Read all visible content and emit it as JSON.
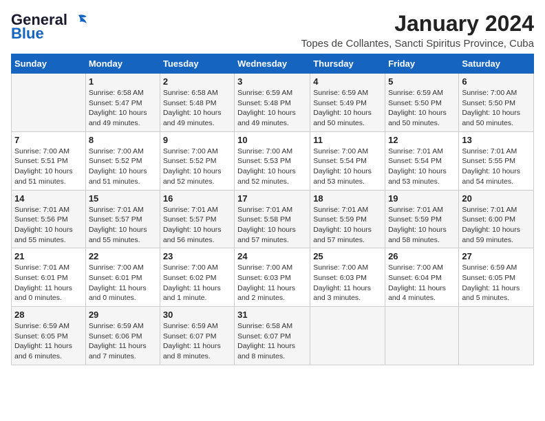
{
  "header": {
    "logo_general": "General",
    "logo_blue": "Blue",
    "title": "January 2024",
    "subtitle": "Topes de Collantes, Sancti Spiritus Province, Cuba"
  },
  "weekdays": [
    "Sunday",
    "Monday",
    "Tuesday",
    "Wednesday",
    "Thursday",
    "Friday",
    "Saturday"
  ],
  "weeks": [
    [
      {
        "day": "",
        "info": ""
      },
      {
        "day": "1",
        "info": "Sunrise: 6:58 AM\nSunset: 5:47 PM\nDaylight: 10 hours\nand 49 minutes."
      },
      {
        "day": "2",
        "info": "Sunrise: 6:58 AM\nSunset: 5:48 PM\nDaylight: 10 hours\nand 49 minutes."
      },
      {
        "day": "3",
        "info": "Sunrise: 6:59 AM\nSunset: 5:48 PM\nDaylight: 10 hours\nand 49 minutes."
      },
      {
        "day": "4",
        "info": "Sunrise: 6:59 AM\nSunset: 5:49 PM\nDaylight: 10 hours\nand 50 minutes."
      },
      {
        "day": "5",
        "info": "Sunrise: 6:59 AM\nSunset: 5:50 PM\nDaylight: 10 hours\nand 50 minutes."
      },
      {
        "day": "6",
        "info": "Sunrise: 7:00 AM\nSunset: 5:50 PM\nDaylight: 10 hours\nand 50 minutes."
      }
    ],
    [
      {
        "day": "7",
        "info": "Sunrise: 7:00 AM\nSunset: 5:51 PM\nDaylight: 10 hours\nand 51 minutes."
      },
      {
        "day": "8",
        "info": "Sunrise: 7:00 AM\nSunset: 5:52 PM\nDaylight: 10 hours\nand 51 minutes."
      },
      {
        "day": "9",
        "info": "Sunrise: 7:00 AM\nSunset: 5:52 PM\nDaylight: 10 hours\nand 52 minutes."
      },
      {
        "day": "10",
        "info": "Sunrise: 7:00 AM\nSunset: 5:53 PM\nDaylight: 10 hours\nand 52 minutes."
      },
      {
        "day": "11",
        "info": "Sunrise: 7:00 AM\nSunset: 5:54 PM\nDaylight: 10 hours\nand 53 minutes."
      },
      {
        "day": "12",
        "info": "Sunrise: 7:01 AM\nSunset: 5:54 PM\nDaylight: 10 hours\nand 53 minutes."
      },
      {
        "day": "13",
        "info": "Sunrise: 7:01 AM\nSunset: 5:55 PM\nDaylight: 10 hours\nand 54 minutes."
      }
    ],
    [
      {
        "day": "14",
        "info": "Sunrise: 7:01 AM\nSunset: 5:56 PM\nDaylight: 10 hours\nand 55 minutes."
      },
      {
        "day": "15",
        "info": "Sunrise: 7:01 AM\nSunset: 5:57 PM\nDaylight: 10 hours\nand 55 minutes."
      },
      {
        "day": "16",
        "info": "Sunrise: 7:01 AM\nSunset: 5:57 PM\nDaylight: 10 hours\nand 56 minutes."
      },
      {
        "day": "17",
        "info": "Sunrise: 7:01 AM\nSunset: 5:58 PM\nDaylight: 10 hours\nand 57 minutes."
      },
      {
        "day": "18",
        "info": "Sunrise: 7:01 AM\nSunset: 5:59 PM\nDaylight: 10 hours\nand 57 minutes."
      },
      {
        "day": "19",
        "info": "Sunrise: 7:01 AM\nSunset: 5:59 PM\nDaylight: 10 hours\nand 58 minutes."
      },
      {
        "day": "20",
        "info": "Sunrise: 7:01 AM\nSunset: 6:00 PM\nDaylight: 10 hours\nand 59 minutes."
      }
    ],
    [
      {
        "day": "21",
        "info": "Sunrise: 7:01 AM\nSunset: 6:01 PM\nDaylight: 11 hours\nand 0 minutes."
      },
      {
        "day": "22",
        "info": "Sunrise: 7:00 AM\nSunset: 6:01 PM\nDaylight: 11 hours\nand 0 minutes."
      },
      {
        "day": "23",
        "info": "Sunrise: 7:00 AM\nSunset: 6:02 PM\nDaylight: 11 hours\nand 1 minute."
      },
      {
        "day": "24",
        "info": "Sunrise: 7:00 AM\nSunset: 6:03 PM\nDaylight: 11 hours\nand 2 minutes."
      },
      {
        "day": "25",
        "info": "Sunrise: 7:00 AM\nSunset: 6:03 PM\nDaylight: 11 hours\nand 3 minutes."
      },
      {
        "day": "26",
        "info": "Sunrise: 7:00 AM\nSunset: 6:04 PM\nDaylight: 11 hours\nand 4 minutes."
      },
      {
        "day": "27",
        "info": "Sunrise: 6:59 AM\nSunset: 6:05 PM\nDaylight: 11 hours\nand 5 minutes."
      }
    ],
    [
      {
        "day": "28",
        "info": "Sunrise: 6:59 AM\nSunset: 6:05 PM\nDaylight: 11 hours\nand 6 minutes."
      },
      {
        "day": "29",
        "info": "Sunrise: 6:59 AM\nSunset: 6:06 PM\nDaylight: 11 hours\nand 7 minutes."
      },
      {
        "day": "30",
        "info": "Sunrise: 6:59 AM\nSunset: 6:07 PM\nDaylight: 11 hours\nand 8 minutes."
      },
      {
        "day": "31",
        "info": "Sunrise: 6:58 AM\nSunset: 6:07 PM\nDaylight: 11 hours\nand 8 minutes."
      },
      {
        "day": "",
        "info": ""
      },
      {
        "day": "",
        "info": ""
      },
      {
        "day": "",
        "info": ""
      }
    ]
  ]
}
